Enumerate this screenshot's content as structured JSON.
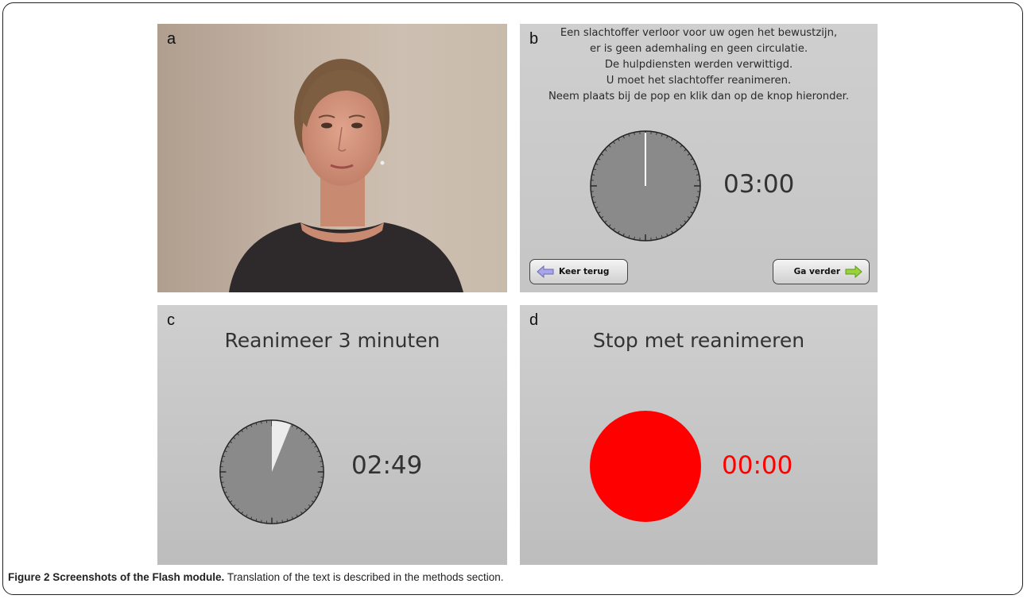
{
  "panels": {
    "a": {
      "label": "a"
    },
    "b": {
      "label": "b",
      "intro_lines": [
        "Een slachtoffer verloor voor uw ogen het bewustzijn,",
        "er is geen ademhaling en geen circulatie.",
        "De hulpdiensten werden verwittigd.",
        "U moet het slachtoffer reanimeren.",
        "Neem plaats bij de pop en klik dan op de knop hieronder."
      ],
      "timer": "03:00",
      "back_button": "Keer terug",
      "next_button": "Ga verder",
      "elapsed_fraction": 0
    },
    "c": {
      "label": "c",
      "heading": "Reanimeer 3 minuten",
      "timer": "02:49",
      "elapsed_fraction": 0.061
    },
    "d": {
      "label": "d",
      "heading": "Stop met reanimeren",
      "timer": "00:00",
      "indicator_color": "#ff0000"
    }
  },
  "caption": {
    "bold": "Figure 2 Screenshots of the Flash module.",
    "text": " Translation of the text is described in the methods section."
  }
}
